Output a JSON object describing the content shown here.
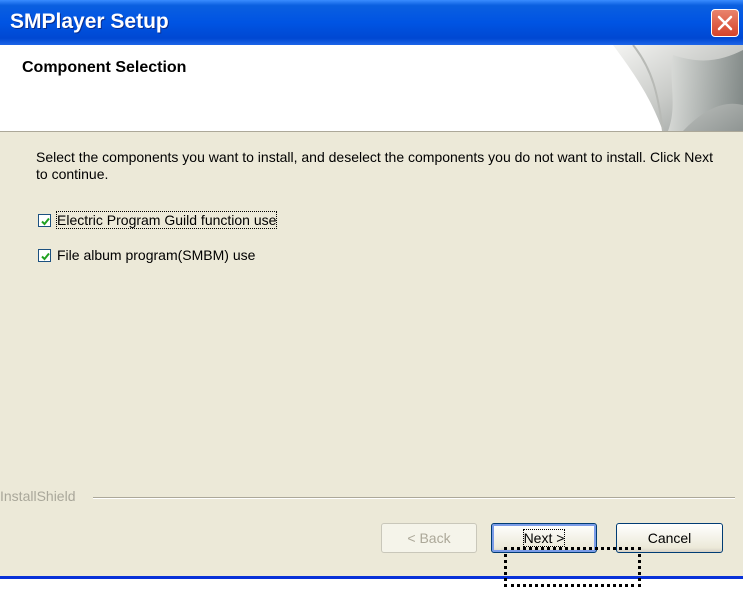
{
  "window": {
    "title": "SMPlayer Setup",
    "close_icon": "close-icon",
    "colors": {
      "titlebar": "#0054e3",
      "body": "#ece9d8",
      "close": "#d5432b"
    }
  },
  "header": {
    "heading": "Component Selection",
    "graphic_icon": "page-curl-graphic"
  },
  "content": {
    "description": "Select the components you want to install, and deselect the components you do not want to install.  Click Next to continue.",
    "options": [
      {
        "label": "Electric Program Guild function use",
        "checked": true
      },
      {
        "label": "File album program(SMBM) use",
        "checked": true
      }
    ]
  },
  "footer": {
    "brand": "InstallShield",
    "back_label": "< Back",
    "next_label": "Next >",
    "cancel_label": "Cancel"
  }
}
